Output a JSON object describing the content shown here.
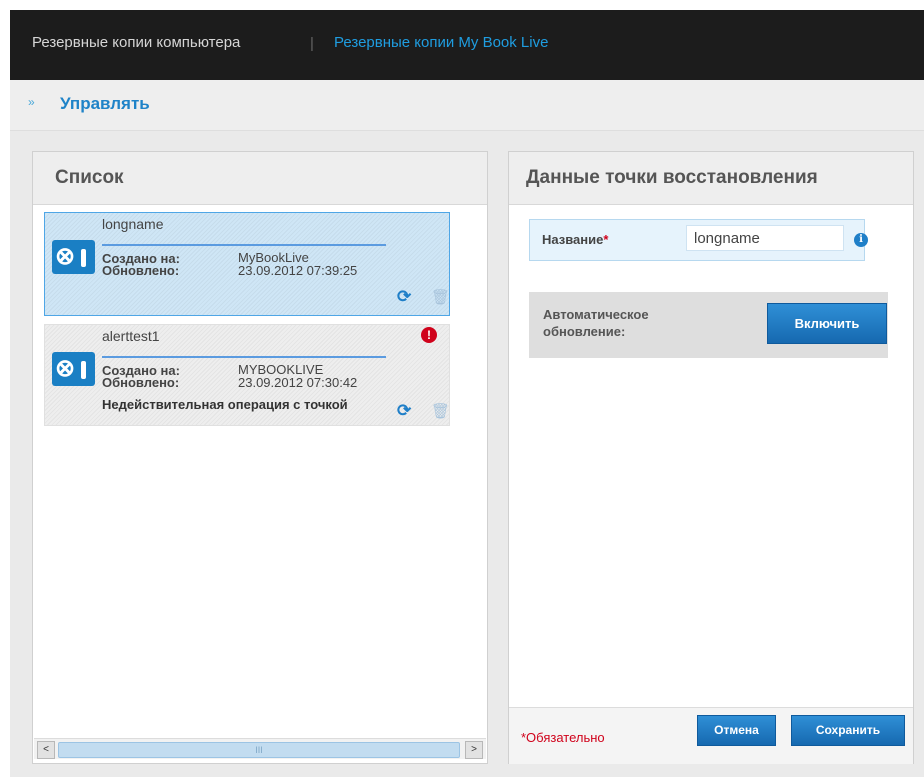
{
  "header": {
    "tab_computer_backups": "Резервные копии компьютера",
    "separator": "|",
    "tab_mybook_backups": "Резервные копии My Book Live"
  },
  "manage": {
    "chevron": "»",
    "label": "Управлять"
  },
  "list_panel": {
    "title": "Список",
    "items": [
      {
        "name": "longname",
        "created_label": "Создано на:",
        "updated_label": "Обновлено:",
        "created_value": "MyBookLive",
        "updated_value": "23.09.2012 07:39:25",
        "selected": true
      },
      {
        "name": "alerttest1",
        "created_label": "Создано на:",
        "updated_label": "Обновлено:",
        "created_value": "MYBOOKLIVE",
        "updated_value": "23.09.2012 07:30:42",
        "error_text": "Недействительная операция с точкой",
        "alert_glyph": "!"
      }
    ],
    "icon_glyph": "⊗",
    "refresh_glyph": "⟳",
    "trash_glyph": "🗑",
    "scroll": {
      "left": "<",
      "right": ">",
      "grip": "III"
    }
  },
  "detail_panel": {
    "title": "Данные точки восстановления",
    "name_label": "Название",
    "required_star": "*",
    "name_value": "longname",
    "info_glyph": "i",
    "auto_update_label": "Автоматическое обновление:",
    "enable_button": "Включить",
    "required_note": "*Обязательно",
    "cancel_button": "Отмена",
    "save_button": "Сохранить"
  },
  "colors": {
    "header_bg": "#1c1c1c",
    "accent_blue": "#1f9de0",
    "button_blue": "#1669b0",
    "selected_bg": "#cfe6f6",
    "required_red": "#d0021b"
  }
}
